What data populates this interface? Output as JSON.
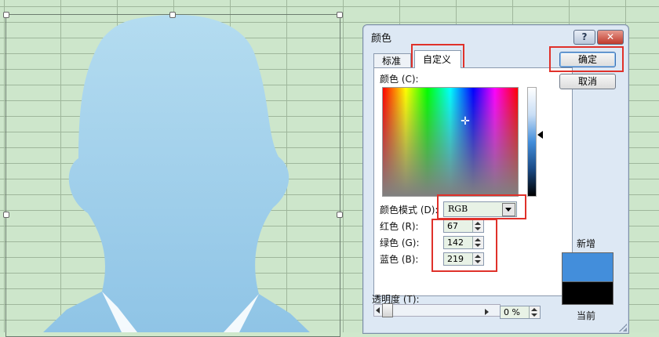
{
  "dialog": {
    "title": "颜色",
    "help_label": "?",
    "close_label": "✕",
    "tabs": [
      {
        "label": "标准",
        "active": false
      },
      {
        "label": "自定义",
        "active": true
      }
    ],
    "colors_label": "颜色 (C):",
    "color_model_label": "颜色模式 (D):",
    "color_model_value": "RGB",
    "red_label": "红色 (R):",
    "green_label": "绿色 (G):",
    "blue_label": "蓝色 (B):",
    "red": "67",
    "green": "142",
    "blue": "219",
    "transparency_label": "透明度 (T):",
    "transparency_value": "0 %",
    "ok_label": "确定",
    "cancel_label": "取消",
    "new_label": "新增",
    "current_label": "当前",
    "new_color": "#438edb",
    "current_color": "#000000"
  },
  "colors": {
    "highlight": "#e0312a",
    "sheet_background": "#cde6cb",
    "silhouette": "#b4dcf0"
  }
}
